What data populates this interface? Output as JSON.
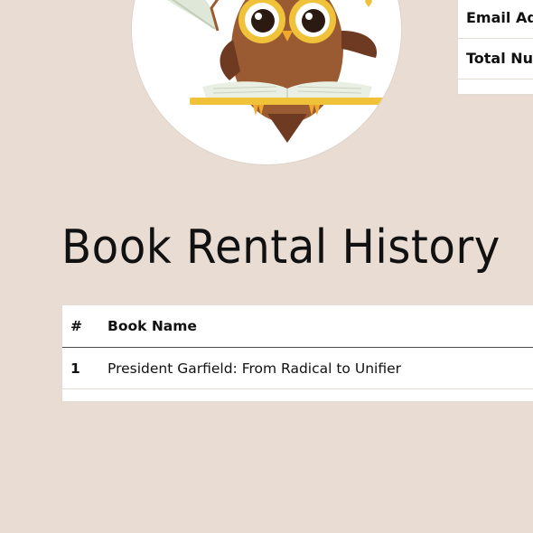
{
  "profile": {
    "avatar_description": "owl-reading-book-icon"
  },
  "user_info": {
    "rows": [
      {
        "label": "Email Addr"
      },
      {
        "label": "Total Numb"
      }
    ]
  },
  "rental_history": {
    "title": "Book Rental History",
    "columns": {
      "number": "#",
      "book_name": "Book Name"
    },
    "rows": [
      {
        "number": "1",
        "book_name": "President Garfield: From Radical to Unifier"
      }
    ]
  },
  "colors": {
    "background": "#e9ddd3",
    "owl_body": "#9a5b33",
    "owl_accent": "#f0c23a",
    "book_page": "#e9f0e3"
  }
}
